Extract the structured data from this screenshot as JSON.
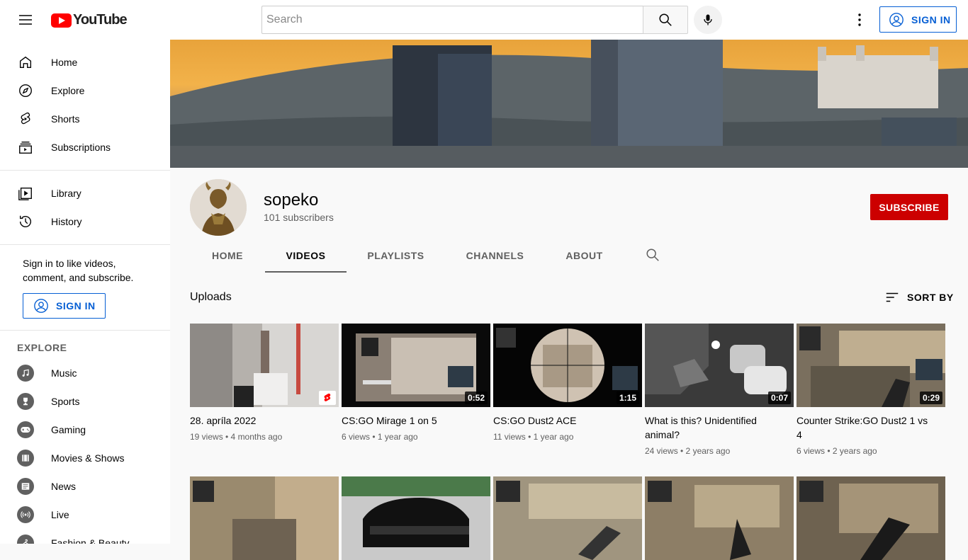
{
  "header": {
    "logo_text": "YouTube",
    "search_placeholder": "Search",
    "signin_label": "SIGN IN"
  },
  "sidebar": {
    "main_items": [
      {
        "label": "Home",
        "icon": "home-icon"
      },
      {
        "label": "Explore",
        "icon": "compass-icon"
      },
      {
        "label": "Shorts",
        "icon": "shorts-icon"
      },
      {
        "label": "Subscriptions",
        "icon": "subscriptions-icon"
      }
    ],
    "library_items": [
      {
        "label": "Library",
        "icon": "library-icon"
      },
      {
        "label": "History",
        "icon": "history-icon"
      }
    ],
    "signin_prompt": "Sign in to like videos, comment, and subscribe.",
    "signin_label": "SIGN IN",
    "explore_heading": "EXPLORE",
    "explore_items": [
      {
        "label": "Music",
        "icon": "music-icon"
      },
      {
        "label": "Sports",
        "icon": "trophy-icon"
      },
      {
        "label": "Gaming",
        "icon": "gamepad-icon"
      },
      {
        "label": "Movies & Shows",
        "icon": "film-icon"
      },
      {
        "label": "News",
        "icon": "news-icon"
      },
      {
        "label": "Live",
        "icon": "live-icon"
      },
      {
        "label": "Fashion & Beauty",
        "icon": "hanger-icon"
      }
    ]
  },
  "channel": {
    "name": "sopeko",
    "subscribers": "101 subscribers",
    "subscribe_label": "SUBSCRIBE",
    "tabs": [
      "HOME",
      "VIDEOS",
      "PLAYLISTS",
      "CHANNELS",
      "ABOUT"
    ],
    "active_tab": "VIDEOS"
  },
  "content": {
    "section_title": "Uploads",
    "sort_label": "SORT BY",
    "videos": [
      {
        "title": "28. apríla 2022",
        "meta": "19 views • 4 months ago",
        "duration": "",
        "is_short": true
      },
      {
        "title": "CS:GO Mirage 1 on 5",
        "meta": "6 views • 1 year ago",
        "duration": "0:52",
        "is_short": false
      },
      {
        "title": "CS:GO Dust2 ACE",
        "meta": "11 views • 1 year ago",
        "duration": "1:15",
        "is_short": false
      },
      {
        "title": "What is this? Unidentified animal?",
        "meta": "24 views • 2 years ago",
        "duration": "0:07",
        "is_short": false
      },
      {
        "title": "Counter Strike:GO Dust2 1 vs 4",
        "meta": "6 views • 2 years ago",
        "duration": "0:29",
        "is_short": false
      }
    ]
  },
  "colors": {
    "accent_blue": "#065fd4",
    "subscribe_red": "#cc0000",
    "logo_red": "#ff0000"
  }
}
